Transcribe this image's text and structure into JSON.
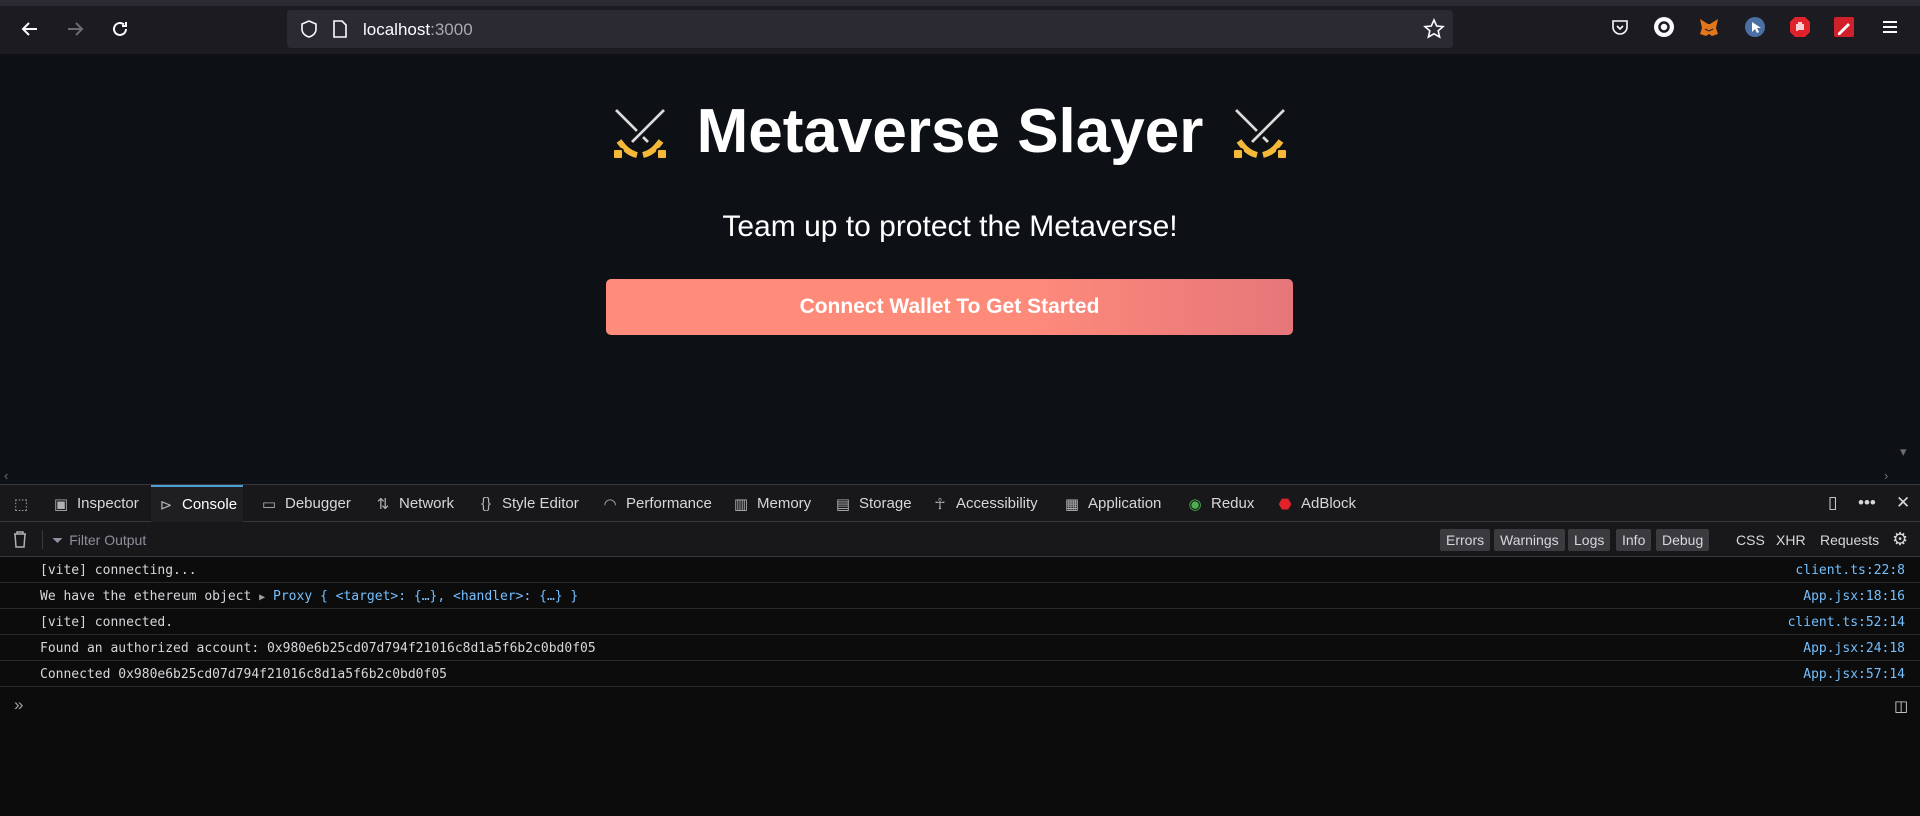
{
  "browser": {
    "url_host": "localhost",
    "url_port": ":3000"
  },
  "page": {
    "title": "Metaverse Slayer",
    "subtitle": "Team up to protect the Metaverse!",
    "cta_label": "Connect Wallet To Get Started"
  },
  "devtools": {
    "tabs": [
      {
        "label": "Inspector",
        "icon": "inspector-icon"
      },
      {
        "label": "Console",
        "icon": "console-icon",
        "active": true
      },
      {
        "label": "Debugger",
        "icon": "debugger-icon"
      },
      {
        "label": "Network",
        "icon": "network-icon"
      },
      {
        "label": "Style Editor",
        "icon": "style-editor-icon"
      },
      {
        "label": "Performance",
        "icon": "performance-icon"
      },
      {
        "label": "Memory",
        "icon": "memory-icon"
      },
      {
        "label": "Storage",
        "icon": "storage-icon"
      },
      {
        "label": "Accessibility",
        "icon": "accessibility-icon"
      },
      {
        "label": "Application",
        "icon": "application-icon"
      },
      {
        "label": "Redux",
        "icon": "redux-icon"
      },
      {
        "label": "AdBlock",
        "icon": "adblock-icon"
      }
    ],
    "filter_placeholder": "Filter Output",
    "levels": [
      "Errors",
      "Warnings",
      "Logs",
      "Info",
      "Debug"
    ],
    "requests": [
      "CSS",
      "XHR",
      "Requests"
    ],
    "logs": [
      {
        "message": "[vite] connecting...",
        "source": "client.ts:22:8"
      },
      {
        "message": "We have the ethereum object ",
        "proxy": "Proxy { <target>: {…}, <handler>: {…} }",
        "source": "App.jsx:18:16"
      },
      {
        "message": "[vite] connected.",
        "source": "client.ts:52:14"
      },
      {
        "message": "Found an authorized account: 0x980e6b25cd07d794f21016c8d1a5f6b2c0bd0f05",
        "source": "App.jsx:24:18"
      },
      {
        "message": "Connected 0x980e6b25cd07d794f21016c8d1a5f6b2c0bd0f05",
        "source": "App.jsx:57:14"
      }
    ]
  }
}
